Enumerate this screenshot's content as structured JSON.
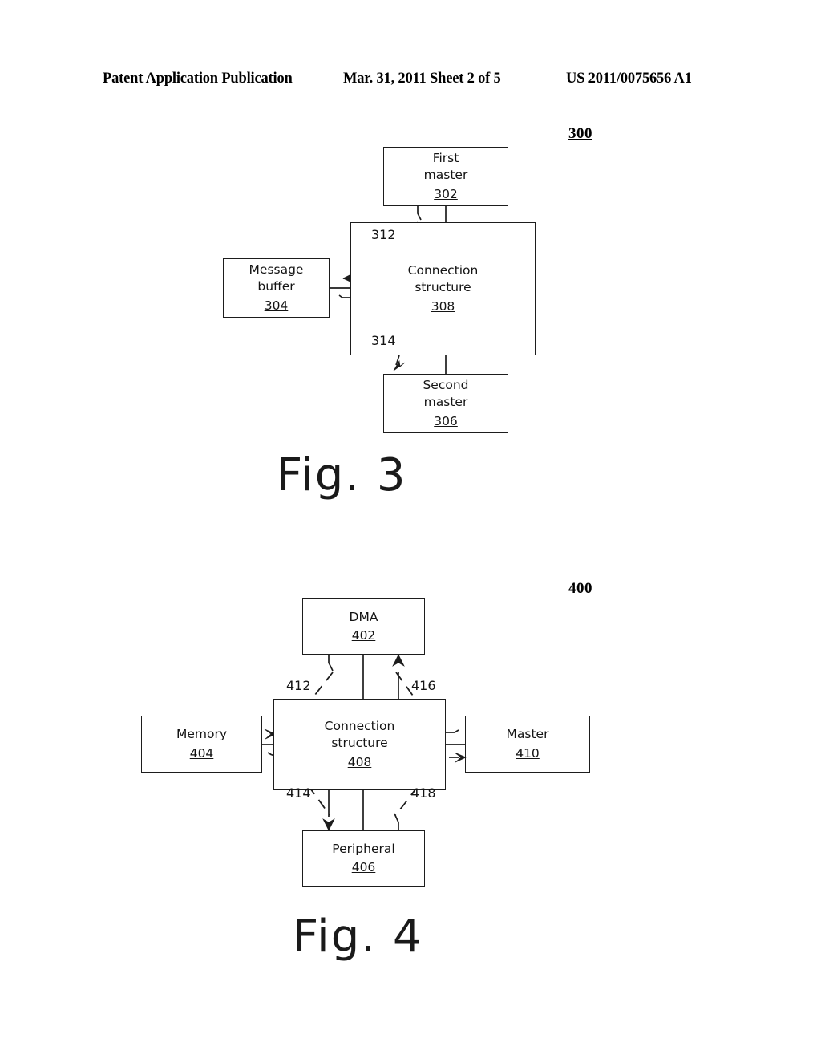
{
  "header": {
    "left": "Patent Application Publication",
    "middle": "Mar. 31, 2011  Sheet 2 of 5",
    "right": "US 2011/0075656 A1"
  },
  "figures": [
    {
      "id": "fig3",
      "ref_label": "300",
      "caption": "Fig. 3",
      "boxes": [
        {
          "name": "first-master",
          "lines": [
            "First",
            "master"
          ],
          "num": "302"
        },
        {
          "name": "message-buffer",
          "lines": [
            "Message",
            "buffer"
          ],
          "num": "304"
        },
        {
          "name": "second-master",
          "lines": [
            "Second",
            "master"
          ],
          "num": "306"
        },
        {
          "name": "connection-structure",
          "lines": [
            "Connection",
            "structure"
          ],
          "num": "308"
        }
      ],
      "arc_labels": [
        {
          "name": "arc-312",
          "text": "312"
        },
        {
          "name": "arc-314",
          "text": "314"
        }
      ]
    },
    {
      "id": "fig4",
      "ref_label": "400",
      "caption": "Fig. 4",
      "boxes": [
        {
          "name": "dma",
          "lines": [
            "DMA"
          ],
          "num": "402"
        },
        {
          "name": "memory",
          "lines": [
            "Memory"
          ],
          "num": "404"
        },
        {
          "name": "peripheral",
          "lines": [
            "Peripheral"
          ],
          "num": "406"
        },
        {
          "name": "master",
          "lines": [
            "Master"
          ],
          "num": "410"
        },
        {
          "name": "connection-structure",
          "lines": [
            "Connection",
            "structure"
          ],
          "num": "408"
        }
      ],
      "arc_labels": [
        {
          "name": "arc-412",
          "text": "412"
        },
        {
          "name": "arc-414",
          "text": "414"
        },
        {
          "name": "arc-416",
          "text": "416"
        },
        {
          "name": "arc-418",
          "text": "418"
        }
      ]
    }
  ]
}
